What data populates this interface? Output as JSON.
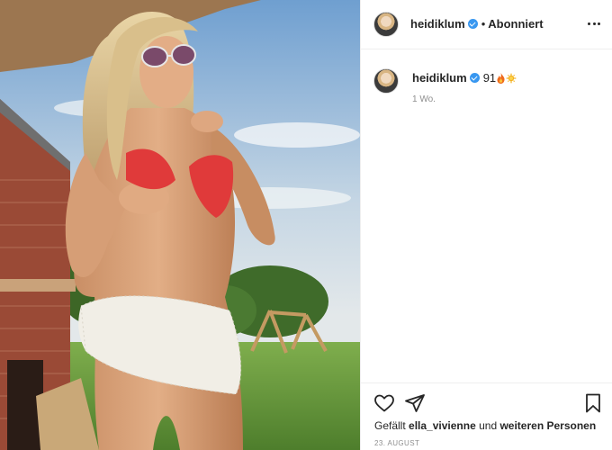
{
  "post": {
    "username": "heidiklum",
    "follow_status": "Abonniert",
    "separator": "•",
    "photo_alt": "Foto von heidiklum"
  },
  "caption": {
    "username": "heidiklum",
    "text": "91",
    "emojis": [
      "fire",
      "sun"
    ],
    "time_ago": "1 Wo."
  },
  "actions": {
    "icons": [
      "heart-icon",
      "paper-plane-icon",
      "bookmark-icon"
    ],
    "likes_prefix": "Gefällt",
    "likes_user": "ella_vivienne",
    "likes_middle": "und",
    "likes_others": "weiteren Personen",
    "date": "23. AUGUST"
  },
  "colors": {
    "verified": "#3897f0",
    "text": "#262626",
    "muted": "#8e8e8e",
    "border": "#efefef"
  }
}
